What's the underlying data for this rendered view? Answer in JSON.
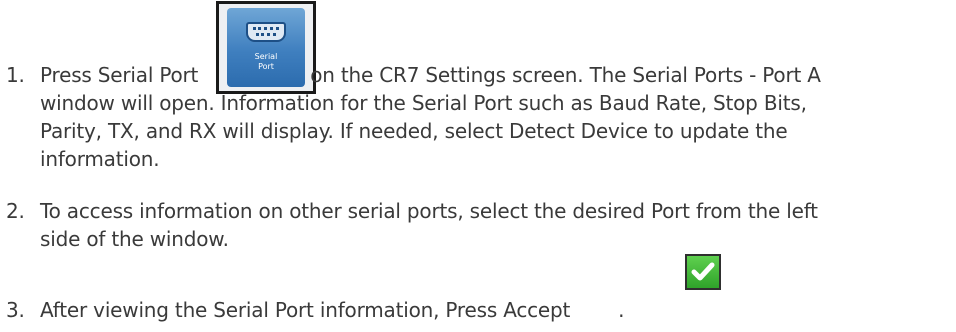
{
  "icons": {
    "serial_port": {
      "name": "serial-port-icon",
      "label_line1": "Serial",
      "label_line2": "Port",
      "colors": {
        "tile": "#3f7fbf",
        "frame": "#1a1a1a"
      }
    },
    "accept": {
      "name": "accept-checkmark-icon",
      "colors": {
        "fill": "#2fa32a",
        "check": "#ffffff"
      }
    }
  },
  "steps": [
    {
      "number": "1.",
      "lines": [
        "Press Serial Port",
        "on the CR7 Settings screen. The Serial Ports - Port A",
        "window will open. Information for the Serial Port such as Baud Rate, Stop Bits,",
        "Parity, TX, and RX will display. If needed, select Detect Device to update the",
        "information."
      ]
    },
    {
      "number": "2.",
      "lines": [
        "To access information on other serial ports, select the desired Port from the left",
        "side of the window."
      ]
    },
    {
      "number": "3.",
      "lines": [
        "After viewing the Serial Port information, Press Accept",
        "."
      ]
    }
  ]
}
